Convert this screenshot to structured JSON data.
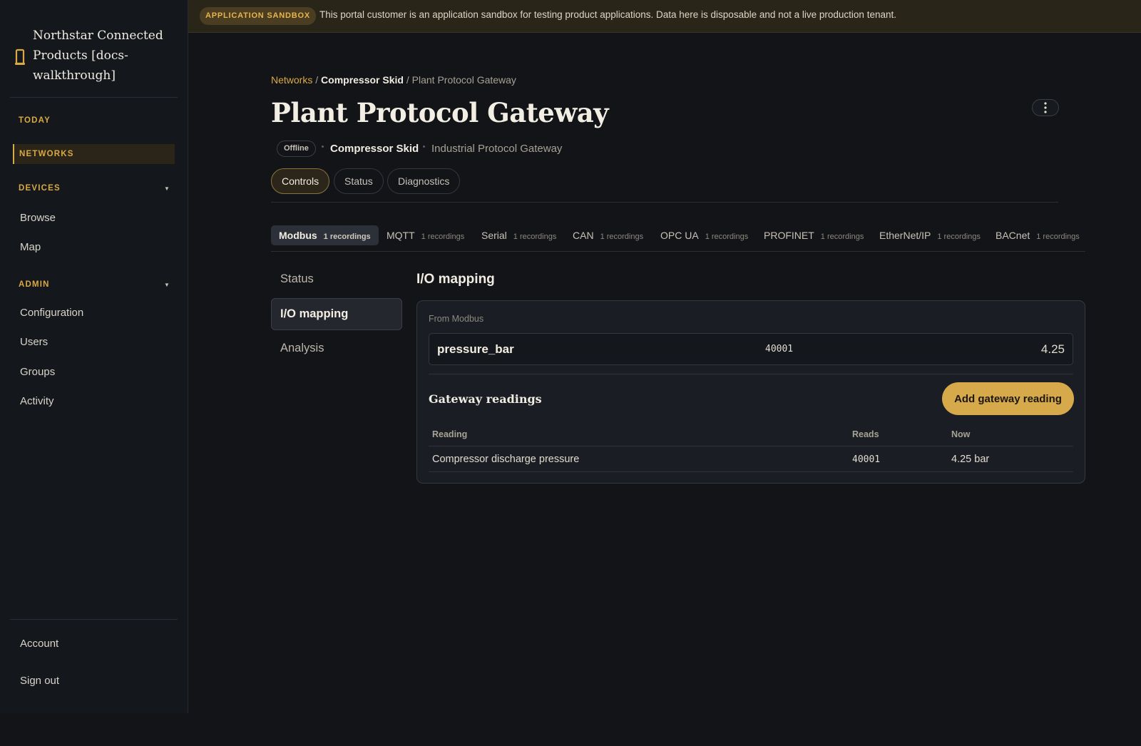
{
  "brand": {
    "name": "Northstar Connected Products [docs-walkthrough]",
    "icon": "gateway-icon",
    "accent": "#d8a945"
  },
  "sidebar": {
    "today": "TODAY",
    "networks": "NETWORKS",
    "devices": {
      "label": "DEVICES",
      "items": [
        "Browse",
        "Map"
      ]
    },
    "admin": {
      "label": "ADMIN",
      "items": [
        "Configuration",
        "Users",
        "Groups",
        "Activity"
      ]
    },
    "footer": {
      "account": "Account",
      "sign_out": "Sign out"
    }
  },
  "banner": {
    "badge": "APPLICATION SANDBOX",
    "text": "This portal customer is an application sandbox for testing product applications. Data here is disposable and not a live production tenant."
  },
  "breadcrumb": {
    "root": "Networks",
    "network": "Compressor Skid",
    "current": "Plant Protocol Gateway",
    "sep": "/"
  },
  "page": {
    "title": "Plant Protocol Gateway",
    "status": "Offline",
    "network": "Compressor Skid",
    "device_type": "Industrial Protocol Gateway"
  },
  "tabs": [
    "Controls",
    "Status",
    "Diagnostics"
  ],
  "protocols": [
    {
      "name": "Modbus",
      "count": "1 recordings"
    },
    {
      "name": "MQTT",
      "count": "1 recordings"
    },
    {
      "name": "Serial",
      "count": "1 recordings"
    },
    {
      "name": "CAN",
      "count": "1 recordings"
    },
    {
      "name": "OPC UA",
      "count": "1 recordings"
    },
    {
      "name": "PROFINET",
      "count": "1 recordings"
    },
    {
      "name": "EtherNet/IP",
      "count": "1 recordings"
    },
    {
      "name": "BACnet",
      "count": "1 recordings"
    }
  ],
  "subnav": [
    "Status",
    "I/O mapping",
    "Analysis"
  ],
  "io": {
    "title": "I/O mapping",
    "from_label": "From Modbus",
    "mapping": {
      "name": "pressure_bar",
      "register": "40001",
      "value": "4.25"
    },
    "readings_title": "Gateway readings",
    "add_button": "Add gateway reading",
    "columns": [
      "Reading",
      "Reads",
      "Now"
    ],
    "rows": [
      {
        "reading": "Compressor discharge pressure",
        "reads": "40001",
        "now": "4.25 bar"
      }
    ]
  }
}
